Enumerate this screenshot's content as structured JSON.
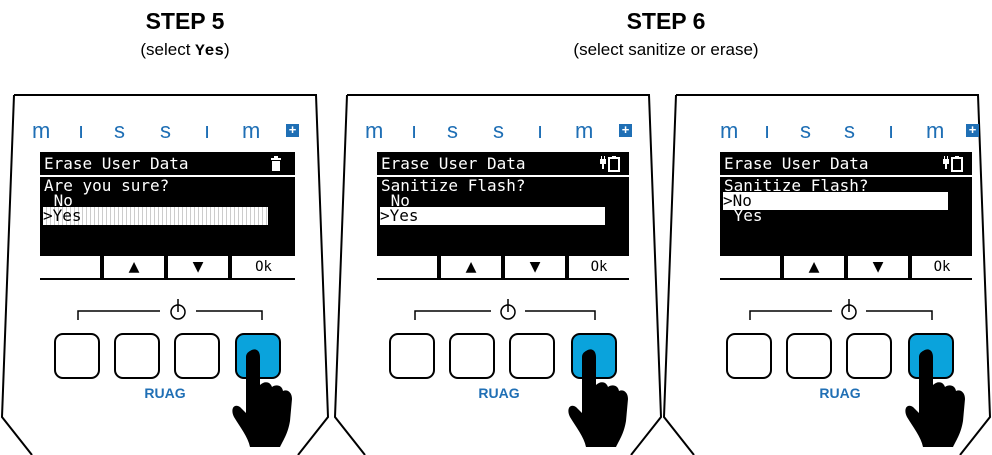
{
  "step5": {
    "title": "STEP 5",
    "subtitle_prefix": "(select ",
    "subtitle_code": "Yes",
    "subtitle_suffix": ")"
  },
  "step6": {
    "title": "STEP 6",
    "subtitle": "(select sanitize or erase)"
  },
  "brand": {
    "letters": [
      "m",
      "ı",
      "s",
      "s",
      "ı",
      "m"
    ],
    "plus": "+"
  },
  "devices": [
    {
      "screen_title": "Erase User Data",
      "question": "Are you sure?",
      "options": [
        " No",
        ">Yes"
      ],
      "selected_index": 1,
      "status_icon": "trash-icon",
      "active_button": 4
    },
    {
      "screen_title": "Erase User Data",
      "question": "Sanitize Flash?",
      "options": [
        " No",
        ">Yes"
      ],
      "selected_index": 1,
      "status_icon": "plug-battery-icon",
      "active_button": 4
    },
    {
      "screen_title": "Erase User Data",
      "question": "Sanitize Flash?",
      "options": [
        ">No",
        " Yes"
      ],
      "selected_index": 0,
      "status_icon": "plug-battery-icon",
      "active_button": 4
    }
  ],
  "softkeys": {
    "key1": "",
    "key2": "▲",
    "key3": "▼",
    "key4": "Ok"
  },
  "maker": "RUAG",
  "colors": {
    "brand_blue": "#1f6fb5",
    "button_active": "#0aa3dc"
  }
}
